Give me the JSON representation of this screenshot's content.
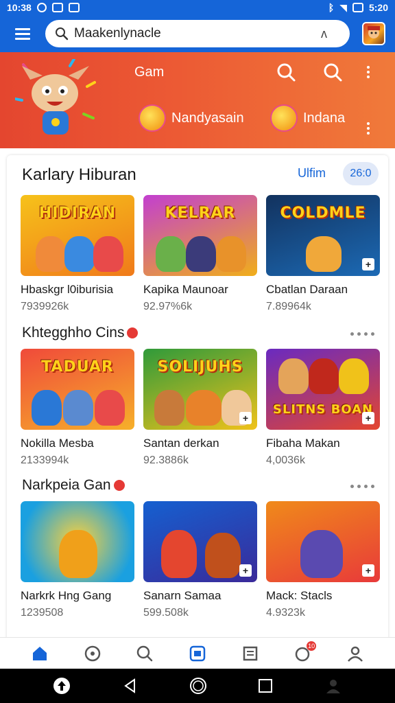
{
  "status_bar": {
    "time_left": "10:38",
    "time_right": "5:20"
  },
  "search": {
    "value": "Maakenlynacle",
    "voice_label": "ʌ"
  },
  "hero": {
    "title": "Gam",
    "chips": [
      {
        "label": "Nandyasain"
      },
      {
        "label": "Indana"
      }
    ]
  },
  "sections": [
    {
      "title": "Karlary Hiburan",
      "see_all": "Ulfim",
      "count": "26:0",
      "cards": [
        {
          "thumb_label": "HIDIRAN",
          "title": "Hbaskgr l0iburisia",
          "count": "7939926k",
          "colors": [
            "#f6c21a",
            "#f07a1a"
          ]
        },
        {
          "thumb_label": "KELRAR",
          "title": "Kapika Maunoar",
          "count": "92.97%6k",
          "colors": [
            "#c23fd0",
            "#f0ae1a"
          ]
        },
        {
          "thumb_label": "COLDMLE",
          "title": "Cbatlan Daraan",
          "count": "7.89964k",
          "colors": [
            "#12325e",
            "#1c6ab5"
          ]
        }
      ]
    },
    {
      "title": "Khtegghho Cins",
      "cards": [
        {
          "thumb_label": "TADUAR",
          "title": "Nokilla Mesba",
          "count": "2133994k",
          "colors": [
            "#f04a3a",
            "#f6b02a"
          ]
        },
        {
          "thumb_label": "SOLIJUHS",
          "title": "Santan derkan",
          "count": "92.3886k",
          "colors": [
            "#2f9a3a",
            "#f0c21a"
          ]
        },
        {
          "thumb_label": "SLITNS BOAN",
          "title": "Fibaha Makan",
          "count": "4,0036k",
          "colors": [
            "#6a2ac0",
            "#e4462f"
          ]
        }
      ]
    },
    {
      "title": "Narkpeia Gan",
      "cards": [
        {
          "thumb_label": "",
          "title": "Narkrk Hng Gang",
          "count": "1239508",
          "colors": [
            "#1aa0e0",
            "#f0a01a"
          ]
        },
        {
          "thumb_label": "",
          "title": "Sanarn Samaa",
          "count": "599.508k",
          "colors": [
            "#1560d0",
            "#e4462f"
          ]
        },
        {
          "thumb_label": "",
          "title": "Mack: Stacls",
          "count": "4.9323k",
          "colors": [
            "#f08a1a",
            "#e83a3a"
          ]
        }
      ]
    }
  ],
  "bottom_nav": {
    "items": [
      {
        "name": "home",
        "icon": "home-icon",
        "active": true
      },
      {
        "name": "games",
        "icon": "gamepad-icon",
        "active": false
      },
      {
        "name": "search",
        "icon": "search-icon",
        "active": false
      },
      {
        "name": "apps",
        "icon": "apps-icon",
        "active": true
      },
      {
        "name": "library",
        "icon": "library-icon",
        "active": false
      },
      {
        "name": "notifications",
        "icon": "bell-icon",
        "badge": "10",
        "active": false
      },
      {
        "name": "profile",
        "icon": "person-icon",
        "active": false
      }
    ]
  },
  "colors": {
    "primary": "#1565d8",
    "hero_start": "#e4462f",
    "hero_end": "#f07a3a",
    "badge": "#e53935"
  }
}
